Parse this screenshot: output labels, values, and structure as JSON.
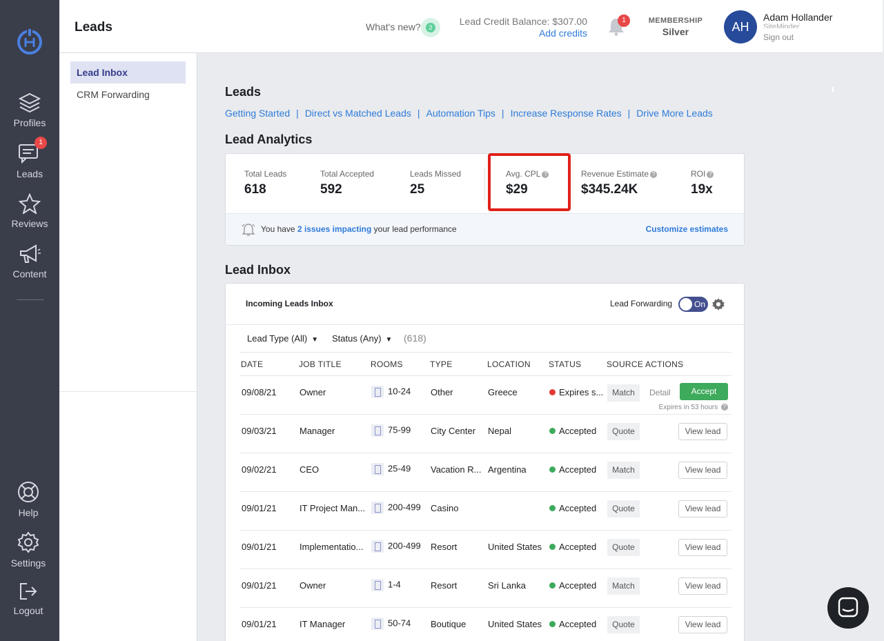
{
  "rail": {
    "items": [
      {
        "label": "Profiles"
      },
      {
        "label": "Leads",
        "badge": "1"
      },
      {
        "label": "Reviews"
      },
      {
        "label": "Content"
      },
      {
        "label": "Help"
      },
      {
        "label": "Settings"
      },
      {
        "label": "Logout"
      }
    ]
  },
  "header": {
    "title": "Leads",
    "whats_new": "What's new?",
    "whats_new_count": "2",
    "credit_balance": "Lead Credit Balance: $307.00",
    "add_credits": "Add credits",
    "notifications_count": "1",
    "membership_label": "MEMBERSHIP",
    "membership_value": "Silver",
    "avatar_initials": "AH",
    "user_name": "Adam Hollander",
    "user_company": "SiteMinder",
    "sign_out": "Sign out"
  },
  "subnav": {
    "items": [
      {
        "label": "Lead Inbox"
      },
      {
        "label": "CRM Forwarding"
      }
    ]
  },
  "main": {
    "leads_heading": "Leads",
    "links": [
      "Getting Started",
      "Direct vs Matched Leads",
      "Automation Tips",
      "Increase Response Rates",
      "Drive More Leads"
    ],
    "link_separator": "|",
    "analytics_heading": "Lead Analytics",
    "stats": [
      {
        "label": "Total Leads",
        "value": "618"
      },
      {
        "label": "Total Accepted",
        "value": "592"
      },
      {
        "label": "Leads Missed",
        "value": "25"
      },
      {
        "label": "Avg. CPL",
        "value": "$29"
      },
      {
        "label": "Revenue Estimate",
        "value": "$345.24K"
      },
      {
        "label": "ROI",
        "value": "19x"
      }
    ],
    "issues_prefix": "You have ",
    "issues_link": "2 issues impacting",
    "issues_suffix": " your lead performance",
    "customize_estimates": "Customize estimates",
    "inbox_heading": "Lead Inbox",
    "inbox": {
      "title": "Incoming Leads Inbox",
      "forwarding_label": "Lead Forwarding",
      "forwarding_state": "On",
      "filter_type": "Lead Type (All)",
      "filter_status": "Status (Any)",
      "count": "(618)",
      "columns": [
        "DATE",
        "JOB TITLE",
        "ROOMS",
        "TYPE",
        "LOCATION",
        "STATUS",
        "SOURCE",
        "ACTIONS"
      ],
      "rows": [
        {
          "date": "09/08/21",
          "job": "Owner",
          "rooms": "10-24",
          "type": "Other",
          "location": "Greece",
          "status": "Expires s...",
          "status_color": "#e53935",
          "source": "Match",
          "action": "Accept",
          "detail": "Detail",
          "note": "Expires in 53 hours"
        },
        {
          "date": "09/03/21",
          "job": "Manager",
          "rooms": "75-99",
          "type": "City Center",
          "location": "Nepal",
          "status": "Accepted",
          "status_color": "#3daa5c",
          "source": "Quote",
          "action": "View lead"
        },
        {
          "date": "09/02/21",
          "job": "CEO",
          "rooms": "25-49",
          "type": "Vacation R...",
          "location": "Argentina",
          "status": "Accepted",
          "status_color": "#3daa5c",
          "source": "Match",
          "action": "View lead"
        },
        {
          "date": "09/01/21",
          "job": "IT Project Man...",
          "rooms": "200-499",
          "type": "Casino",
          "location": "",
          "status": "Accepted",
          "status_color": "#3daa5c",
          "source": "Quote",
          "action": "View lead"
        },
        {
          "date": "09/01/21",
          "job": "Implementatio...",
          "rooms": "200-499",
          "type": "Resort",
          "location": "United States",
          "status": "Accepted",
          "status_color": "#3daa5c",
          "source": "Quote",
          "action": "View lead"
        },
        {
          "date": "09/01/21",
          "job": "Owner",
          "rooms": "1-4",
          "type": "Resort",
          "location": "Sri Lanka",
          "status": "Accepted",
          "status_color": "#3daa5c",
          "source": "Match",
          "action": "View lead"
        },
        {
          "date": "09/01/21",
          "job": "IT Manager",
          "rooms": "50-74",
          "type": "Boutique",
          "location": "United States",
          "status": "Accepted",
          "status_color": "#3daa5c",
          "source": "Quote",
          "action": "View lead"
        }
      ]
    }
  },
  "colors": {
    "rail_bg": "#3a3d4a",
    "link_blue": "#2f7bd8",
    "accept_green": "#3daa5c",
    "highlight_red": "#e0201a",
    "avatar_blue": "#274a9a"
  },
  "icons": [
    "hotel-logo-icon",
    "layers-icon",
    "chat-icon",
    "star-icon",
    "megaphone-icon",
    "lifebuoy-icon",
    "gear-icon",
    "logout-icon",
    "bell-icon",
    "alarm-icon",
    "building-icon",
    "chat-fab-icon"
  ]
}
